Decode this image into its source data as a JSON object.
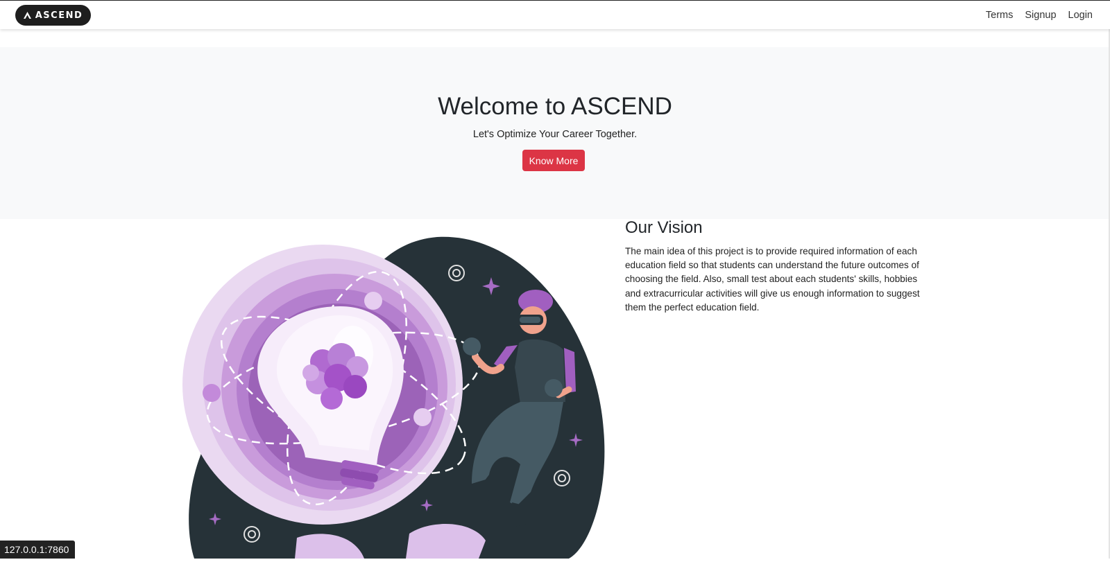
{
  "navbar": {
    "brand_label": "ASCEND",
    "links": [
      {
        "label": "Terms"
      },
      {
        "label": "Signup"
      },
      {
        "label": "Login"
      }
    ]
  },
  "hero": {
    "title": "Welcome to ASCEND",
    "subtitle": "Let's Optimize Your Career Together.",
    "button_label": "Know More"
  },
  "vision": {
    "heading": "Our Vision",
    "body": "The main idea of this project is to provide required information of each education field so that students can understand the future outcomes of choosing the field. Also, small test about each students' skills, hobbies and extracurricular activities will give us enough information to suggest them the perfect education field."
  },
  "status_bar": {
    "url": "127.0.0.1:7860"
  },
  "colors": {
    "brand_bg": "#1e1e1e",
    "hero_bg": "#f8f9fa",
    "primary_button": "#dc3545",
    "illustration_dark": "#263238",
    "illustration_purple": "#a15fc0"
  },
  "illustration": {
    "icon": "lightbulb-vr-person-illustration"
  }
}
